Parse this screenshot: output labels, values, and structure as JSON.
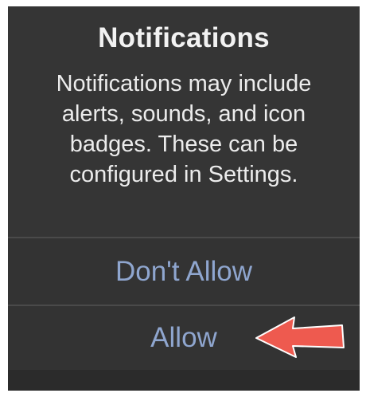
{
  "alert": {
    "title": "Notifications",
    "message": "Notifications may include alerts, sounds, and icon badges. These can be configured in Settings."
  },
  "buttons": {
    "dont_allow": "Don't Allow",
    "allow": "Allow"
  },
  "colors": {
    "background": "#353535",
    "button_text": "#8fa6cf",
    "arrow": "#ee5a4f"
  },
  "icons": {
    "pointer": "red-arrow-icon"
  }
}
